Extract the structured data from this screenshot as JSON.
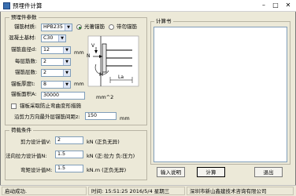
{
  "app": {
    "title": "预埋件计算"
  },
  "params": {
    "group_title": "预埋件参数",
    "material_label": "锚筋材质:",
    "material_value": "HPB235",
    "concrete_label": "混凝土基材:",
    "concrete_value": "C30",
    "diameter_label": "锚筋直径d:",
    "diameter_value": "12",
    "diameter_unit": "mm",
    "layers_label": "每层筋数:",
    "layers_value": "2",
    "rows_label": "锚筋层数:",
    "rows_value": "2",
    "thickness_label": "锚板厚度t:",
    "thickness_value": "8",
    "thickness_unit": "mm",
    "area_label": "锚板面积A:",
    "area_value": "30000",
    "area_unit": "mm^2",
    "radio_plain": "光著锚筋",
    "radio_ribbed": "带勿锚筋",
    "radio_selected": "光著锚筋",
    "checkbox_label": "锚板采取防止弯曲变形措施",
    "checkbox_checked": false,
    "spacing_label": "沿剪力方向最外层锚筋间距z:",
    "spacing_value": "150",
    "spacing_unit": "mm",
    "diagram": {
      "n": "N",
      "v": "V",
      "m": "M",
      "la": "La"
    }
  },
  "loads": {
    "group_title": "荷载条件",
    "shear_label": "剪力设计值V:",
    "shear_value": "2",
    "shear_unit": "kN (正负无异)",
    "axial_label": "法向拉力设计值N:",
    "axial_value": "1.5",
    "axial_unit": "kN (正:拉力 负:压力)",
    "moment_label": "弯矩设计值M:",
    "moment_value": "1.5",
    "moment_unit": "kN.m (正负无异)"
  },
  "calc_book": {
    "title": "计算书",
    "content": ""
  },
  "buttons": {
    "input_desc": "输入说明",
    "calculate": "计算",
    "exit": "退出"
  },
  "status": {
    "state": "启动成功.",
    "time_label": "时间:",
    "time_value": "15:51:25  2016/5/4 星期三",
    "company": "深圳市新山鑫建技术咨询有限公司"
  }
}
